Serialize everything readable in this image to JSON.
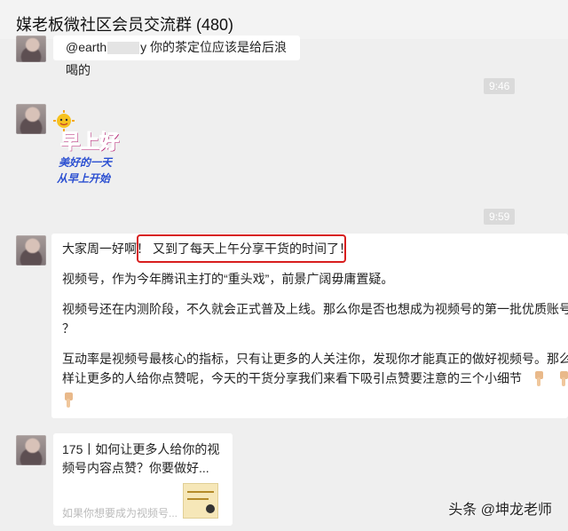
{
  "window": {
    "title": "媒老板微社区会员交流群 (480)"
  },
  "messages": {
    "first": {
      "text_prefix": "@earth",
      "text_suffix": "y 你的茶定位应该是给后浪喝的"
    },
    "time1": "9:46",
    "sticker": {
      "line1": "早上好",
      "line2": "美好的一天",
      "line3": "从早上开始"
    },
    "time2": "9:59",
    "long": {
      "greeting": "大家周一好啊！",
      "highlight": "又到了每天上午分享干货的时间了！",
      "p2": "视频号，作为今年腾讯主打的“重头戏”，前景广阔毋庸置疑。",
      "p3a": "视频号还在内测阶段，不久就会正式普及上线。那么你是否也想成为视频号的第一批优质账号呢",
      "p3b": "？",
      "p4a": "互动率是视频号最核心的指标，只有让更多的人关注你，发现你才能真正的做好视频号。那么怎",
      "p4b": "样让更多的人给你点赞呢，今天的干货分享我们来看下吸引点赞要注意的三个小细节"
    },
    "card": {
      "title": "175丨如何让更多人给你的视频号内容点赞？你要做好...",
      "subtitle": "如果你想要成为视频号..."
    }
  },
  "watermark": "头条 @坤龙老师",
  "colors": {
    "highlight_border": "#d81e1e",
    "background": "#efefef"
  }
}
